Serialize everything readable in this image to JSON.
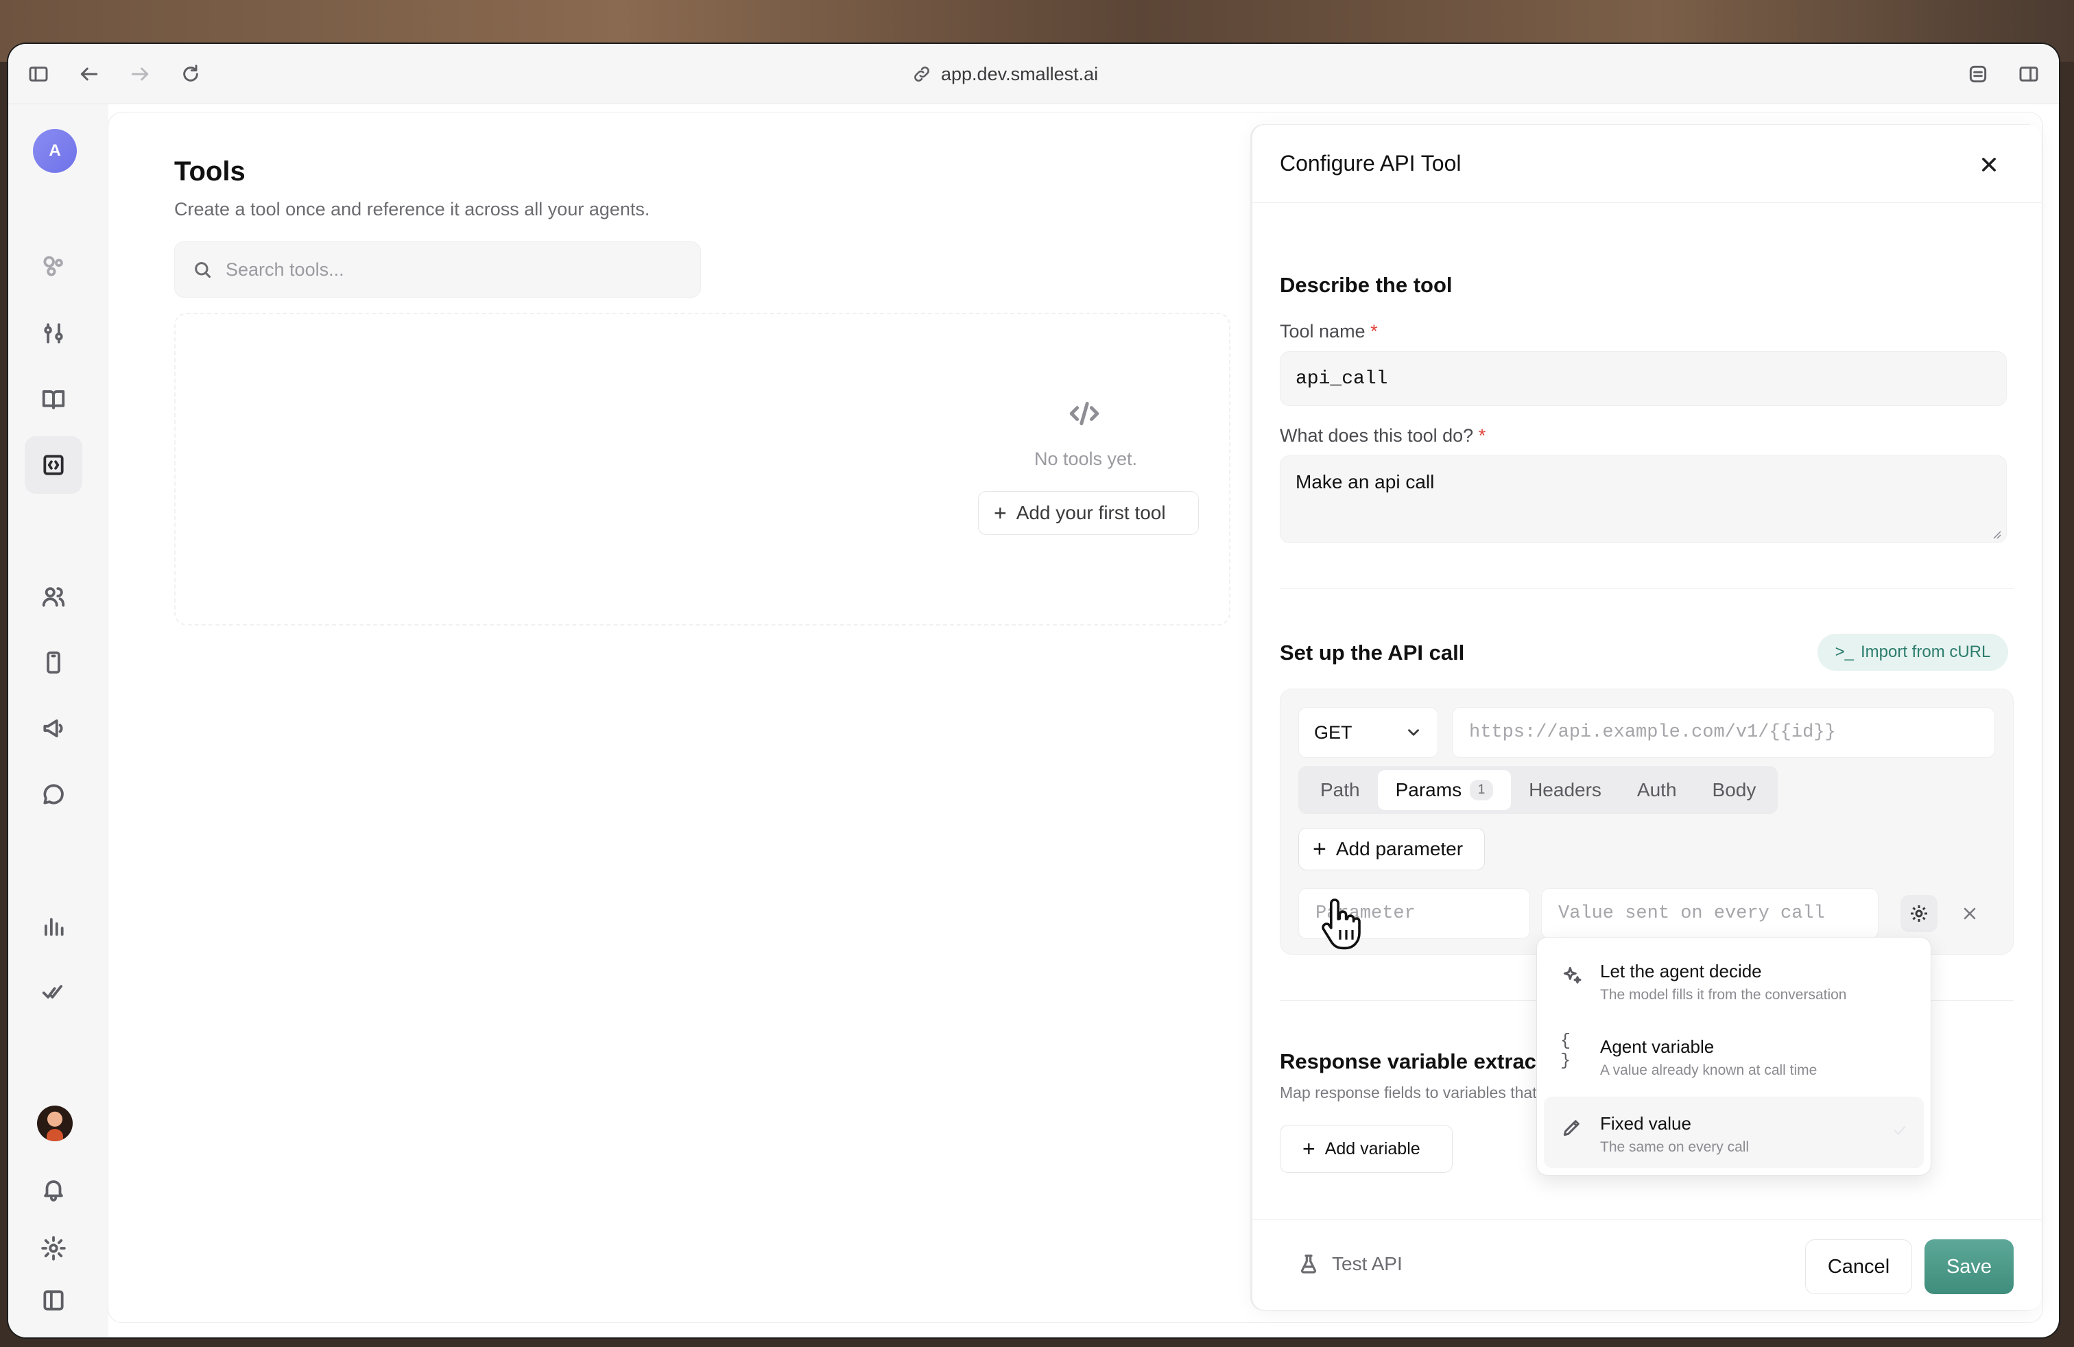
{
  "browser": {
    "url": "app.dev.smallest.ai"
  },
  "sidebar": {
    "workspace_initial": "A",
    "items": [
      {
        "icon": "agents-icon"
      },
      {
        "icon": "sliders-icon"
      },
      {
        "icon": "book-icon"
      },
      {
        "icon": "code-box-icon",
        "active": true
      },
      {
        "icon": "users-icon"
      },
      {
        "icon": "phone-icon"
      },
      {
        "icon": "megaphone-icon"
      },
      {
        "icon": "chat-bubble-icon"
      },
      {
        "icon": "bar-chart-icon"
      },
      {
        "icon": "double-check-icon"
      }
    ]
  },
  "tools_page": {
    "title": "Tools",
    "subtitle": "Create a tool once and reference it across all your agents.",
    "search_placeholder": "Search tools...",
    "empty_text": "No tools yet.",
    "add_first_label": "Add your first tool"
  },
  "drawer": {
    "title": "Configure API Tool",
    "describe_section": "Describe the tool",
    "tool_name_label": "Tool name",
    "required_mark": "*",
    "tool_name_value": "api_call",
    "description_label": "What does this tool do?",
    "description_value": "Make an api call",
    "api_section": "Set up the API call",
    "import_label": "Import from cURL",
    "method": "GET",
    "url_placeholder": "https://api.example.com/v1/{{id}}",
    "tabs": [
      {
        "label": "Path",
        "active": false
      },
      {
        "label": "Params",
        "active": true,
        "badge": "1"
      },
      {
        "label": "Headers",
        "active": false
      },
      {
        "label": "Auth",
        "active": false
      },
      {
        "label": "Body",
        "active": false
      }
    ],
    "add_parameter_label": "Add parameter",
    "param_placeholder": "Parameter",
    "value_placeholder": "Value sent on every call",
    "response_section": "Response variable extraction",
    "response_sub": "Map response fields to variables that can be used later",
    "add_variable_label": "Add variable",
    "test_api_label": "Test API",
    "cancel_label": "Cancel",
    "save_label": "Save"
  },
  "value_mode_menu": {
    "items": [
      {
        "title": "Let the agent decide",
        "description": "The model fills it from the conversation",
        "icon": "sparkle-icon"
      },
      {
        "title": "Agent variable",
        "description": "A value already known at call time",
        "icon": "braces-icon"
      },
      {
        "title": "Fixed value",
        "description": "The same on every call",
        "icon": "pencil-icon",
        "selected": true
      }
    ]
  },
  "colors": {
    "accent": "#3f8d7c",
    "accent_soft": "#e6f3f0",
    "required": "#e0463c",
    "avatar": "#7b7ef0"
  }
}
